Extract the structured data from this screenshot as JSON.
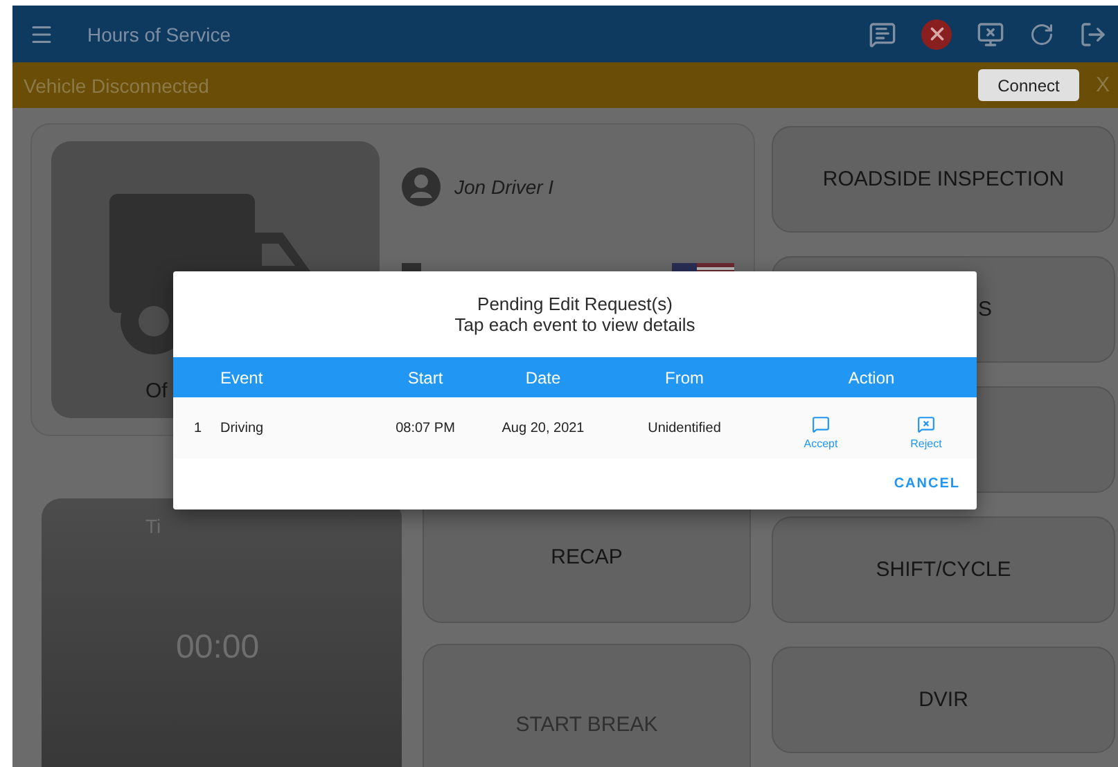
{
  "app_bar": {
    "title": "Hours of Service"
  },
  "banner": {
    "message": "Vehicle Disconnected",
    "button": "Connect",
    "close": "X"
  },
  "status_card": {
    "status": "Of",
    "driver": "Jon Driver I"
  },
  "timer": {
    "label": "Ti",
    "value": "00:00"
  },
  "middle_buttons": [
    {
      "label": "RECAP",
      "disabled": false
    },
    {
      "label": "START BREAK",
      "disabled": true
    }
  ],
  "right_buttons": [
    {
      "label": "ROADSIDE INSPECTION",
      "kind": "full"
    },
    {
      "label": "S",
      "kind": "covered"
    },
    {
      "kind": "blank"
    },
    {
      "label": "SHIFT/CYCLE",
      "kind": "full"
    },
    {
      "label": "DVIR",
      "kind": "full"
    }
  ],
  "dialog": {
    "title": "Pending Edit Request(s)",
    "subtitle": "Tap each event to view details",
    "columns": [
      "Event",
      "Start",
      "Date",
      "From",
      "Action"
    ],
    "rows": [
      {
        "index": "1",
        "event": "Driving",
        "start": "08:07 PM",
        "date": "Aug 20, 2021",
        "from": "Unidentified",
        "accept": "Accept",
        "reject": "Reject"
      }
    ],
    "cancel": "CANCEL"
  }
}
